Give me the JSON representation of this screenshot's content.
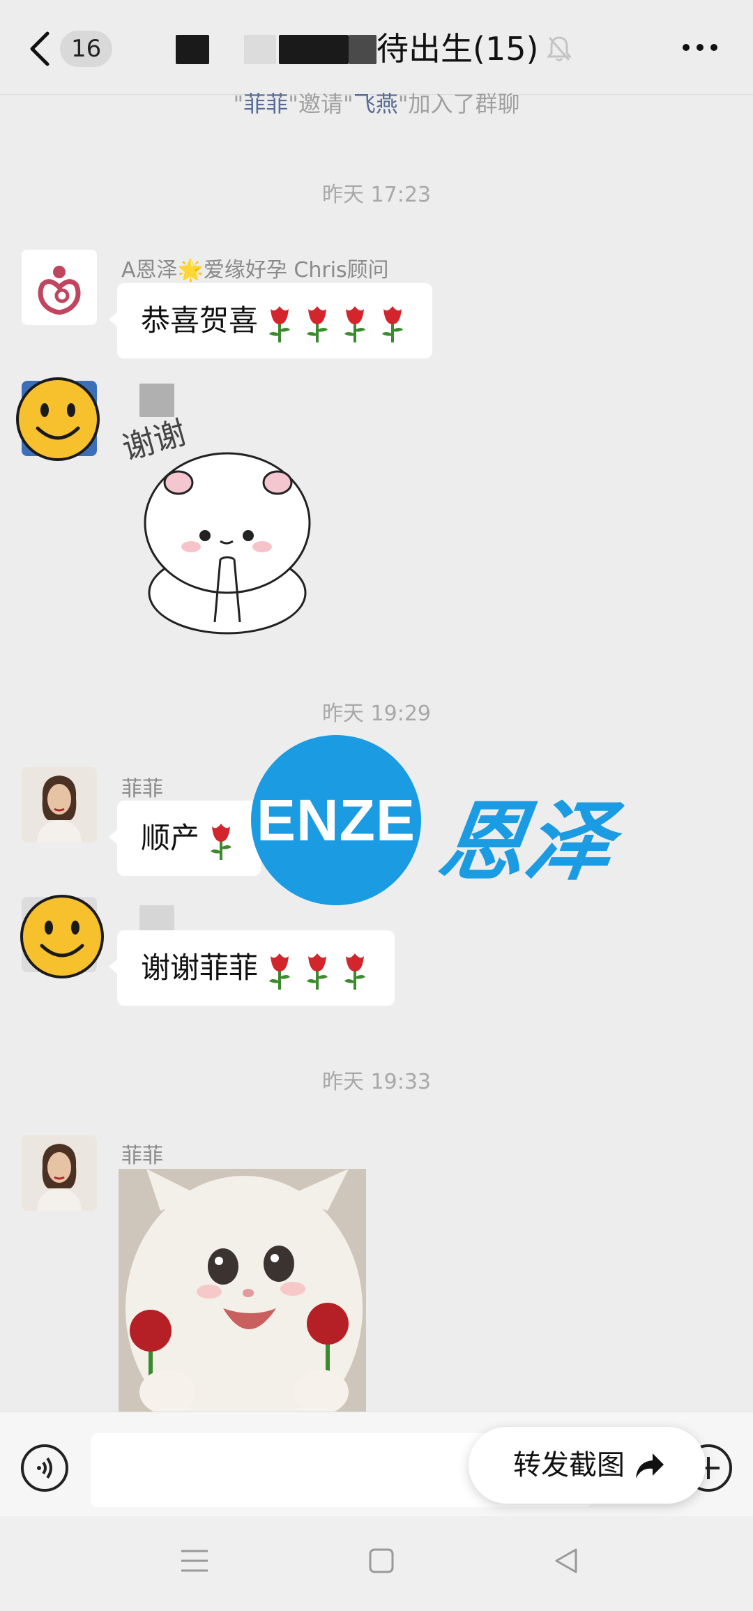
{
  "header": {
    "unread_count": "16",
    "title": "待出生(15)"
  },
  "system_notice": {
    "inviter": "菲菲",
    "action": "邀请",
    "invitee": "飞燕",
    "suffix": "加入了群聊"
  },
  "timestamps": [
    "昨天 17:23",
    "昨天 19:29",
    "昨天 19:33"
  ],
  "messages": [
    {
      "sender": "A恩泽🌟爱缘好孕 Chris顾问",
      "text": "恭喜贺喜",
      "roses": 4
    },
    {
      "sender": "",
      "sticker": "谢谢"
    },
    {
      "sender": "菲菲",
      "text": "顺产",
      "roses": 1
    },
    {
      "sender": "",
      "text": "谢谢菲菲",
      "roses": 3
    },
    {
      "sender": "菲菲",
      "sticker": "cat-with-roses"
    }
  ],
  "watermark": {
    "logo": "ENZE",
    "text": "恩泽",
    "color": "#1a9be2"
  },
  "input_bar": {
    "forward_label": "转发截图"
  },
  "icons": [
    "back-icon",
    "mute-bell-icon",
    "more-icon",
    "voice-icon",
    "plus-icon",
    "forward-arrow-icon",
    "nav-menu-icon",
    "nav-home-icon",
    "nav-back-icon",
    "rose-icon",
    "smiley-icon"
  ]
}
